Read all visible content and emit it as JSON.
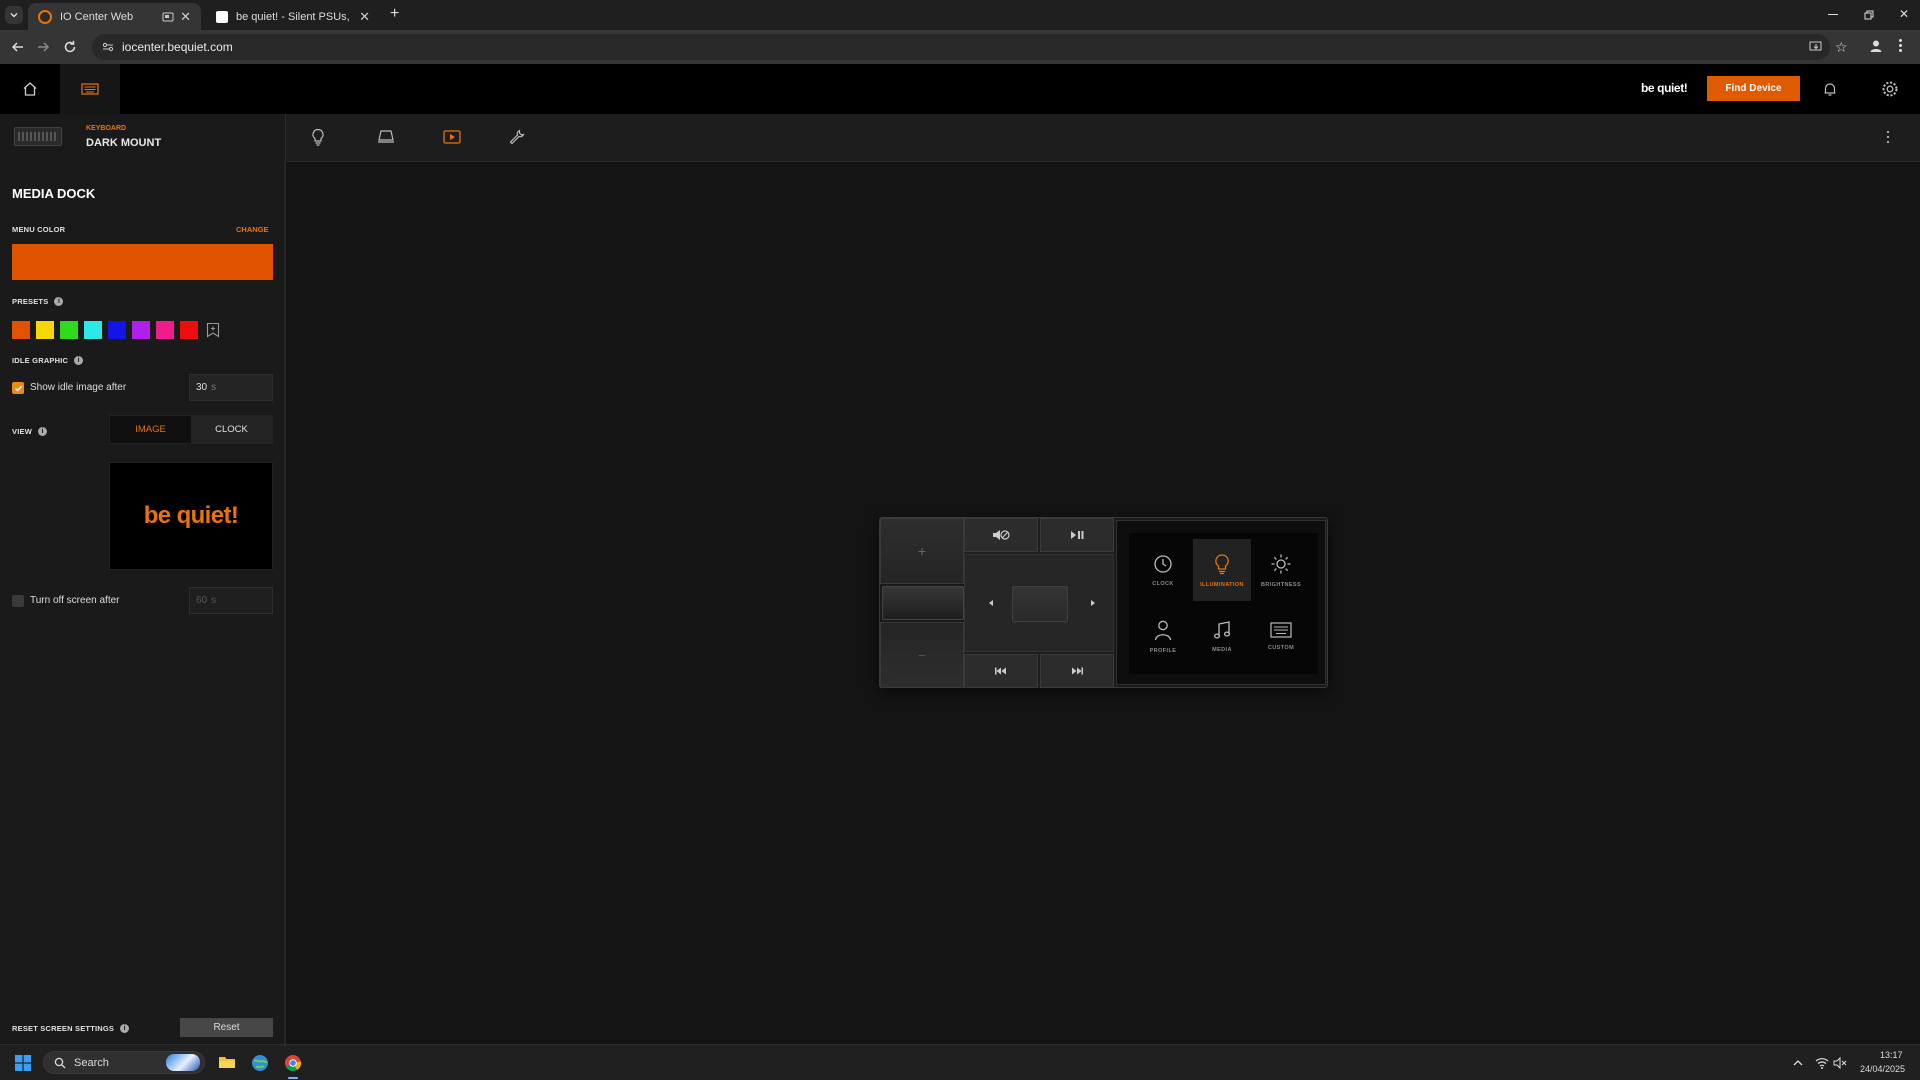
{
  "browser": {
    "tabs": [
      {
        "title": "IO Center Web",
        "active": true
      },
      {
        "title": "be quiet! - Silent PSUs, cases an",
        "active": false
      }
    ],
    "new_tab": "+",
    "url": "iocenter.bequiet.com"
  },
  "header": {
    "logo": "be quiet!",
    "find_device": "Find Device"
  },
  "device": {
    "type": "KEYBOARD",
    "name": "DARK MOUNT"
  },
  "sidebar": {
    "title": "MEDIA DOCK",
    "menu_color_label": "MENU COLOR",
    "change_label": "CHANGE",
    "menu_color": "#e05200",
    "presets_label": "PRESETS",
    "presets": [
      "#e05200",
      "#f5d800",
      "#2fdc1c",
      "#2ee8e8",
      "#1414e6",
      "#b020e8",
      "#ee1c8c",
      "#ee0c0c"
    ],
    "idle_label": "IDLE GRAPHIC",
    "show_idle_label": "Show idle image after",
    "idle_value": "30",
    "idle_unit": "s",
    "view_label": "VIEW",
    "view_image": "IMAGE",
    "view_clock": "CLOCK",
    "preview_logo": "be quiet!",
    "turn_off_label": "Turn off screen after",
    "turn_off_value": "60",
    "turn_off_unit": "s",
    "reset_label": "RESET SCREEN SETTINGS",
    "reset_button": "Reset"
  },
  "dock": {
    "plus": "+",
    "minus": "−",
    "screen_items": [
      {
        "label": "CLOCK",
        "icon": "clock-icon",
        "active": false
      },
      {
        "label": "ILLUMINATION",
        "icon": "bulb-icon",
        "active": true
      },
      {
        "label": "BRIGHTNESS",
        "icon": "sun-icon",
        "active": false
      },
      {
        "label": "PROFILE",
        "icon": "person-icon",
        "active": false
      },
      {
        "label": "MEDIA",
        "icon": "music-icon",
        "active": false
      },
      {
        "label": "CUSTOM",
        "icon": "keyboard-icon",
        "active": false
      }
    ]
  },
  "taskbar": {
    "search": "Search",
    "time": "13:17",
    "date": "24/04/2025"
  },
  "colors": {
    "accent": "#e05a00",
    "orange_text": "#e8730c"
  }
}
